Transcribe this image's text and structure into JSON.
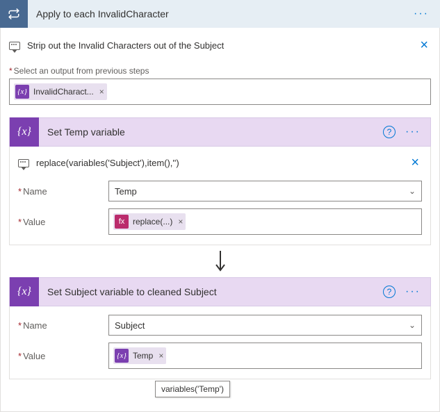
{
  "outer": {
    "title": "Apply to each InvalidCharacter",
    "comment": "Strip out the Invalid Characters out of the Subject",
    "select_label": "Select an output from previous steps",
    "select_token": "InvalidCharact..."
  },
  "step1": {
    "title": "Set Temp variable",
    "comment": "replace(variables('Subject'),item(),'')",
    "name_label": "Name",
    "name_value": "Temp",
    "value_label": "Value",
    "value_token": "replace(...)"
  },
  "step2": {
    "title": "Set Subject variable to cleaned Subject",
    "name_label": "Name",
    "name_value": "Subject",
    "value_label": "Value",
    "value_token": "Temp"
  },
  "tooltip": "variables('Temp')"
}
